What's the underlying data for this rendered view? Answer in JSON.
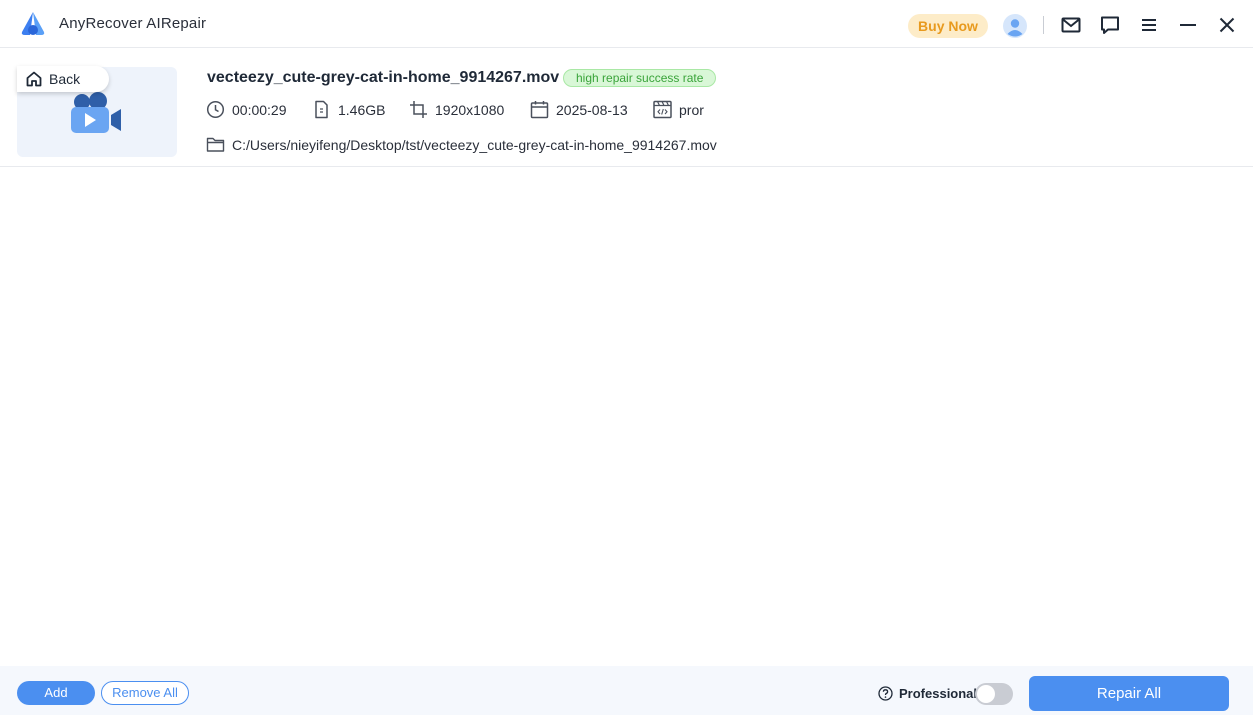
{
  "app": {
    "title": "AnyRecover AIRepair"
  },
  "header": {
    "buy_now": "Buy Now"
  },
  "file": {
    "back_label": "Back",
    "name": "vecteezy_cute-grey-cat-in-home_9914267.mov",
    "badge": "high repair success rate",
    "duration": "00:00:29",
    "size": "1.46GB",
    "resolution": "1920x1080",
    "date": "2025-08-13",
    "codec": "pror",
    "path": "C:/Users/nieyifeng/Desktop/tst/vecteezy_cute-grey-cat-in-home_9914267.mov"
  },
  "footer": {
    "add_label": "Add",
    "remove_all_label": "Remove All",
    "professional_label": "Professional",
    "professional_enabled": false,
    "repair_all_label": "Repair All"
  },
  "colors": {
    "accent": "#4b8ff0",
    "buy_now_bg": "#fdecc8",
    "buy_now_text": "#e89a1e",
    "badge_bg": "#d9f7d7",
    "badge_text": "#3aa43a"
  },
  "icons": [
    "app-logo-icon",
    "avatar-icon",
    "mail-icon",
    "chat-icon",
    "menu-icon",
    "minimize-icon",
    "close-icon",
    "home-icon",
    "video-camera-icon",
    "clock-icon",
    "file-icon",
    "crop-icon",
    "calendar-icon",
    "codec-icon",
    "folder-icon",
    "help-icon"
  ]
}
